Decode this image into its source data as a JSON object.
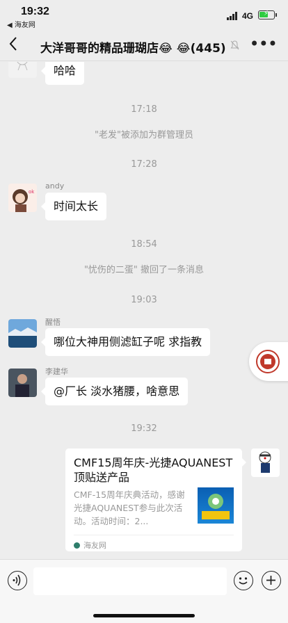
{
  "status_bar": {
    "time": "19:32",
    "back_app": "◀ 海友网",
    "network": "4G"
  },
  "nav": {
    "title": "大洋哥哥的精品珊瑚店😂 😂(445)",
    "more": "•••"
  },
  "messages": [
    {
      "text": "哈哈"
    },
    {
      "timestamp": "17:18"
    },
    {
      "system": "\"老发\"被添加为群管理员"
    },
    {
      "timestamp": "17:28"
    },
    {
      "sender": "andy",
      "text": "时间太长"
    },
    {
      "timestamp": "18:54"
    },
    {
      "system": "\"忧伤的二蛋\" 撤回了一条消息"
    },
    {
      "timestamp": "19:03"
    },
    {
      "sender": "醒悟",
      "text": "哪位大神用侧滤缸子呢  求指教"
    },
    {
      "sender": "李建华",
      "text": "@厂长 淡水猪腰，啥意思"
    },
    {
      "timestamp": "19:32"
    }
  ],
  "card": {
    "title": "CMF15周年庆-光捷AQUANEST顶贴送产品",
    "description": "CMF-15周年庆典活动，感谢光捷AQUANEST参与此次活动。活动时间：2...",
    "source": "海友网"
  },
  "colors": {
    "background": "#ededed",
    "bubble": "#ffffff",
    "muted_text": "#999999"
  }
}
